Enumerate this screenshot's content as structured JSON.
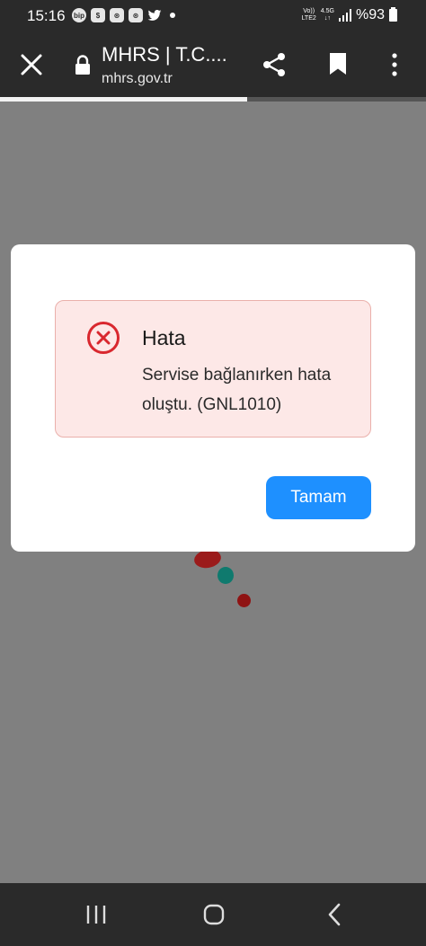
{
  "status_bar": {
    "time": "15:16",
    "apps": [
      "bip",
      "$",
      "⊛",
      "⊛"
    ],
    "network_top": "Vo))",
    "network_bottom": "LTE2",
    "network_gen": "4.5G",
    "battery": "%93"
  },
  "browser": {
    "page_title": "MHRS | T.C....",
    "url": "mhrs.gov.tr",
    "load_progress": 0.58
  },
  "dialog": {
    "alert_title": "Hata",
    "alert_message": "Servise bağlanırken hata oluştu. (GNL1010)",
    "ok_label": "Tamam"
  },
  "colors": {
    "accent": "#1e90ff",
    "error": "#d9282f",
    "alert_background": "#fde8e7"
  },
  "icons": [
    "close-icon",
    "lock-icon",
    "share-icon",
    "bookmark-icon",
    "more-vert-icon",
    "error-icon",
    "recent-apps-icon",
    "home-icon",
    "back-icon"
  ]
}
